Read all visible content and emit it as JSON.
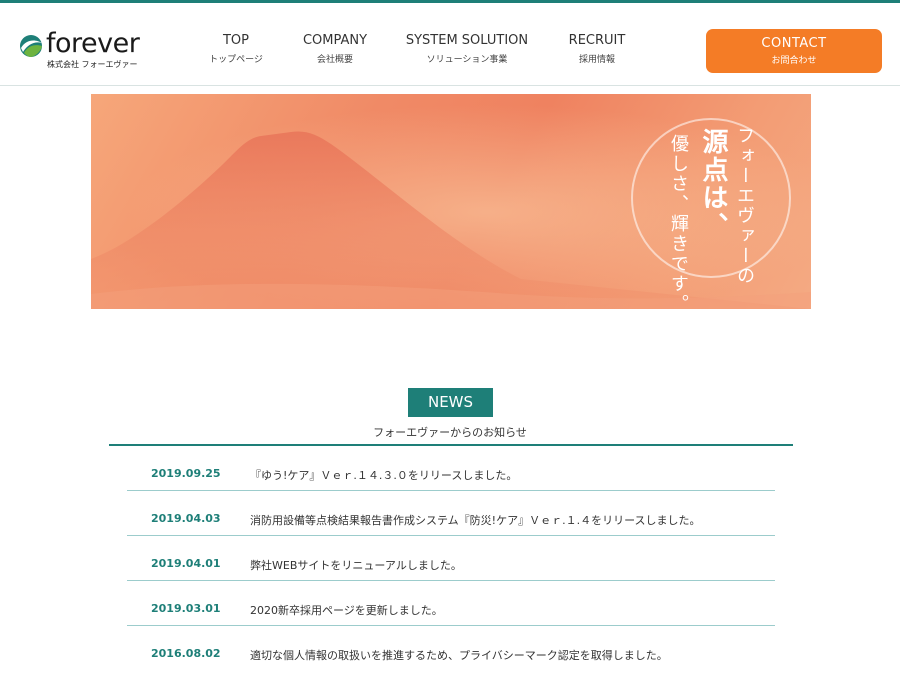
{
  "brand": {
    "logo_text": "forever",
    "company_name": "株式会社 フォーエヴァー"
  },
  "nav": [
    {
      "en": "TOP",
      "ja": "トップページ"
    },
    {
      "en": "COMPANY",
      "ja": "会社概要"
    },
    {
      "en": "SYSTEM SOLUTION",
      "ja": "ソリューション事業"
    },
    {
      "en": "RECRUIT",
      "ja": "採用情報"
    }
  ],
  "contact": {
    "en": "CONTACT",
    "ja": "お問合わせ",
    "color": "#f47c26"
  },
  "hero": {
    "line1": "フォーエヴァーの",
    "line2": "源点は、",
    "line3": "優しさ、輝きです。"
  },
  "news": {
    "label": "NEWS",
    "subtitle": "フォーエヴァーからのお知らせ",
    "items": [
      {
        "date": "2019.09.25",
        "title": "『ゆう!ケア』Ｖｅｒ.１４.３.０をリリースしました。"
      },
      {
        "date": "2019.04.03",
        "title": "消防用設備等点検結果報告書作成システム『防災!ケア』Ｖｅｒ.１.４をリリースしました。"
      },
      {
        "date": "2019.04.01",
        "title": "弊社WEBサイトをリニューアルしました。"
      },
      {
        "date": "2019.03.01",
        "title": "2020新卒採用ページを更新しました。"
      },
      {
        "date": "2016.08.02",
        "title": "適切な個人情報の取扱いを推進するため、プライバシーマーク認定を取得しました。"
      }
    ]
  },
  "colors": {
    "accent": "#1e7f78",
    "contact": "#f47c26"
  }
}
